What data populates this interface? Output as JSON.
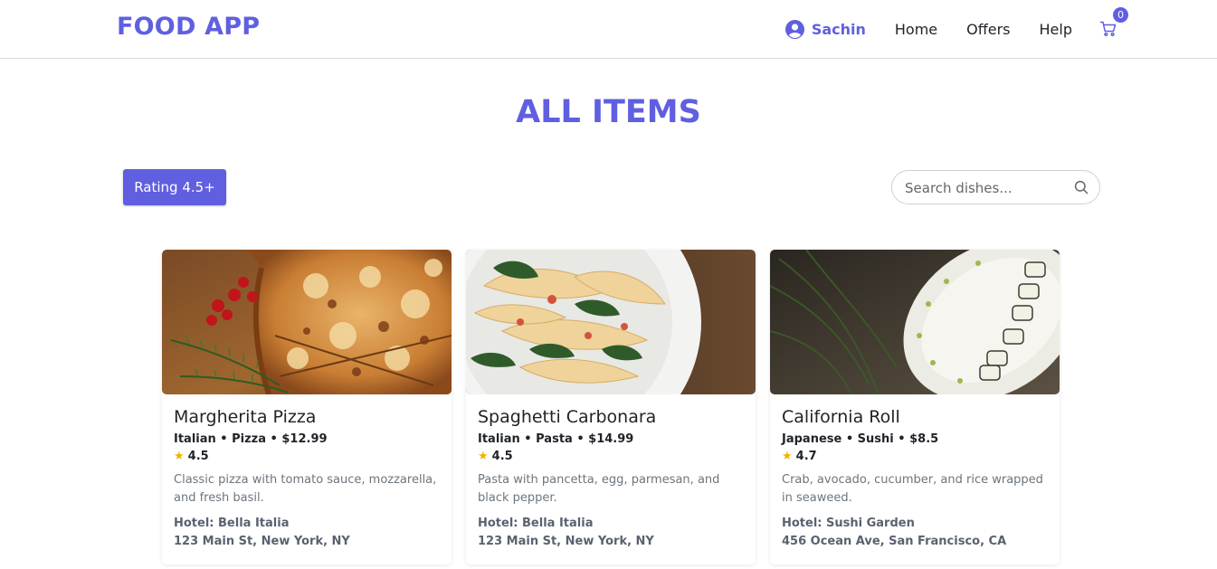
{
  "navbar": {
    "brand": "FOOD APP",
    "user_name": "Sachin",
    "links": [
      "Home",
      "Offers",
      "Help"
    ],
    "cart_count": "0",
    "brand_color": "#5f5fe0"
  },
  "page": {
    "title": "ALL ITEMS"
  },
  "filter": {
    "label": "Rating 4.5+"
  },
  "search": {
    "placeholder": "Search dishes..."
  },
  "items": [
    {
      "name": "Margherita Pizza",
      "meta": "Italian • Pizza • $12.99",
      "rating": "4.5",
      "description": "Classic pizza with tomato sauce, mozzarella, and fresh basil.",
      "hotel": "Hotel: Bella Italia",
      "address": "123 Main St, New York, NY",
      "image": "pizza-photo"
    },
    {
      "name": "Spaghetti Carbonara",
      "meta": "Italian • Pasta • $14.99",
      "rating": "4.5",
      "description": "Pasta with pancetta, egg, parmesan, and black pepper.",
      "hotel": "Hotel: Bella Italia",
      "address": "123 Main St, New York, NY",
      "image": "pasta-photo"
    },
    {
      "name": "California Roll",
      "meta": "Japanese • Sushi • $8.5",
      "rating": "4.7",
      "description": "Crab, avocado, cucumber, and rice wrapped in seaweed.",
      "hotel": "Hotel: Sushi Garden",
      "address": "456 Ocean Ave, San Francisco, CA",
      "image": "sushi-photo"
    }
  ]
}
